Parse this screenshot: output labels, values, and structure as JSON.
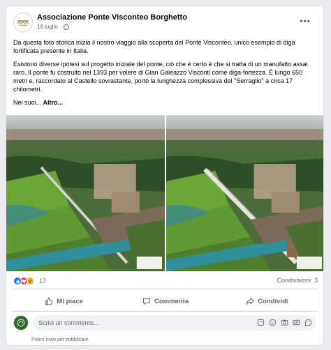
{
  "post": {
    "page_name": "Associazione Ponte Visconteo Borghetto",
    "date": "18 luglio",
    "separator": "·",
    "paragraphs": [
      "Da questa foto storica inizia il nostro viaggio alla scoperta del Ponte Visconteo, unico esempio di diga fortificata presente in Italia.",
      "Esistono diverse ipotesi sul progetto iniziale del ponte, ciò che è certo è che si tratta di un manufatto assai raro. Il ponte fu costruito nel 1393 per volere di Gian Galeazzo Visconti come diga-fortezza. È lungo 650 metri e, raccordato al Castello sovrastante, portò la lunghezza complessiva del \"Serraglio\" a circa 17 chilometri."
    ],
    "truncated_text": "Nei suoi...",
    "see_more": "Altro..."
  },
  "stats": {
    "reaction_icons": [
      "like-icon",
      "love-icon",
      "wow-icon"
    ],
    "reaction_count": "17",
    "shares": "Condivisioni: 3"
  },
  "actions": {
    "like": "Mi piace",
    "comment": "Commenta",
    "share": "Condividi"
  },
  "comment": {
    "placeholder": "Scrivi un commento...",
    "hint": "Premi Invio per pubblicare.",
    "tools": [
      "sticker-icon",
      "emoji-icon",
      "camera-icon",
      "gif-icon",
      "sticker-face-icon"
    ]
  },
  "colors": {
    "accent": "#1877f2",
    "love": "#f33e58",
    "wow": "#f7b125",
    "muted": "#65676b"
  }
}
